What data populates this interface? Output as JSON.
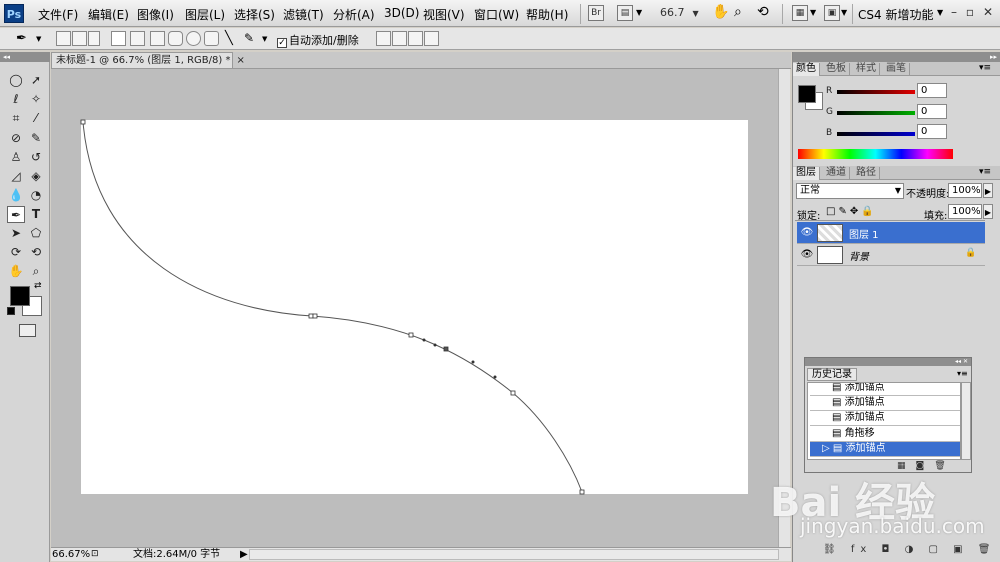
{
  "app": {
    "logo_text": "Ps"
  },
  "menu": [
    "文件(F)",
    "编辑(E)",
    "图像(I)",
    "图层(L)",
    "选择(S)",
    "滤镜(T)",
    "分析(A)",
    "3D(D)",
    "视图(V)",
    "窗口(W)",
    "帮助(H)"
  ],
  "toolbar": {
    "bridge_label": "Br",
    "zoom": "66.7",
    "workspace": "CS4 新增功能"
  },
  "options": {
    "auto_add_delete": "自动添加/删除",
    "auto_add_checked": true
  },
  "document": {
    "tab_title": "未标题-1 @ 66.7% (图层 1, RGB/8) *",
    "zoom_status": "66.67%",
    "doc_info": "文档:2.64M/0 字节"
  },
  "colors": {
    "tab_labels": [
      "颜色",
      "色板",
      "样式",
      "画笔"
    ],
    "channels": [
      {
        "label": "R",
        "value": "0",
        "ramp": "#e00000"
      },
      {
        "label": "G",
        "value": "0",
        "ramp": "#00b000"
      },
      {
        "label": "B",
        "value": "0",
        "ramp": "#0000d0"
      }
    ]
  },
  "layers": {
    "tab_labels": [
      "图层",
      "通道",
      "路径"
    ],
    "blend_mode": "正常",
    "opacity_label": "不透明度:",
    "opacity": "100%",
    "lock_label": "锁定:",
    "fill_label": "填充:",
    "fill": "100%",
    "items": [
      {
        "name": "图层 1",
        "selected": true
      },
      {
        "name": "背景",
        "selected": false
      }
    ]
  },
  "history": {
    "title": "历史记录",
    "items": [
      {
        "label": "添加锚点",
        "selected": false
      },
      {
        "label": "添加锚点",
        "selected": false
      },
      {
        "label": "添加锚点",
        "selected": false
      },
      {
        "label": "角拖移",
        "selected": false
      },
      {
        "label": "添加锚点",
        "selected": true
      }
    ]
  },
  "watermark": {
    "brand": "Bai 经验",
    "url": "jingyan.baidu.com"
  }
}
